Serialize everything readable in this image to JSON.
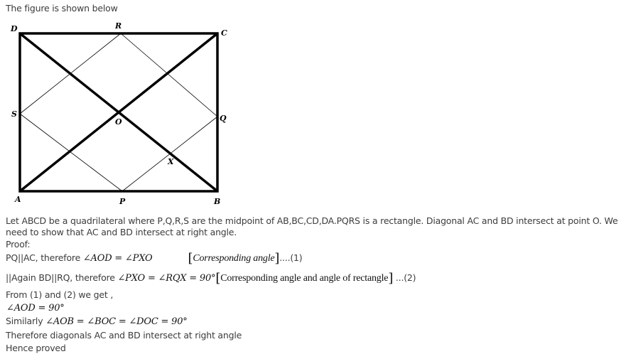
{
  "intro": "The figure is shown below",
  "figure": {
    "labels": {
      "A": "A",
      "B": "B",
      "C": "C",
      "D": "D",
      "P": "P",
      "Q": "Q",
      "R": "R",
      "S": "S",
      "O": "O",
      "X": "X"
    }
  },
  "body": {
    "statement": "Let ABCD be a quadrilateral where P,Q,R,S are the midpoint of AB,BC,CD,DA.PQRS is a rectangle. Diagonal AC and BD intersect at point O. We need to show that AC and BD intersect at right angle.",
    "proof_heading": "Proof:",
    "line1": {
      "text": "PQ||AC, therefore ",
      "math": "∠AOD = ∠PXO",
      "reason": "Corresponding angle",
      "ref": "....(1)"
    },
    "line2": {
      "text": "||Again BD||RQ, therefore ",
      "math": "∠PXO = ∠RQX = 90°",
      "reason": "Corresponding angle and angle of rectangle",
      "ref": " ...(2)"
    },
    "line3": "From (1) and (2) we get ,",
    "line4": "∠AOD = 90°",
    "line5": {
      "text": "Similarly ",
      "math": "∠AOB = ∠BOC = ∠DOC = 90°"
    },
    "line6": "Therefore diagonals AC and BD intersect at right angle",
    "line7": "Hence proved"
  }
}
